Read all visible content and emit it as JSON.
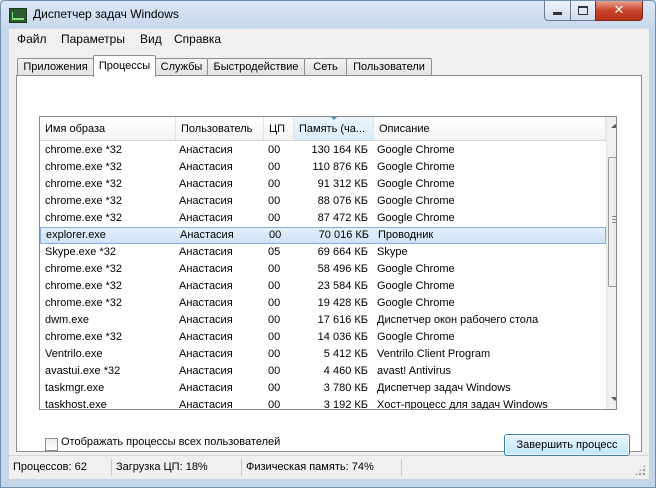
{
  "window": {
    "title": "Диспетчер задач Windows"
  },
  "menu": [
    "Файл",
    "Параметры",
    "Вид",
    "Справка"
  ],
  "tabs": [
    {
      "label": "Приложения",
      "active": false
    },
    {
      "label": "Процессы",
      "active": true
    },
    {
      "label": "Службы",
      "active": false
    },
    {
      "label": "Быстродействие",
      "active": false
    },
    {
      "label": "Сеть",
      "active": false
    },
    {
      "label": "Пользователи",
      "active": false
    }
  ],
  "processes": {
    "columns": [
      "Имя образа",
      "Пользователь",
      "ЦП",
      "Память (ча...",
      "Описание"
    ],
    "sorted_column": "Память (ча...",
    "rows": [
      {
        "name": "chrome.exe *32",
        "user": "Анастасия",
        "cpu": "00",
        "mem": "130 164 КБ",
        "desc": "Google Chrome"
      },
      {
        "name": "chrome.exe *32",
        "user": "Анастасия",
        "cpu": "00",
        "mem": "110 876 КБ",
        "desc": "Google Chrome"
      },
      {
        "name": "chrome.exe *32",
        "user": "Анастасия",
        "cpu": "00",
        "mem": "91 312 КБ",
        "desc": "Google Chrome"
      },
      {
        "name": "chrome.exe *32",
        "user": "Анастасия",
        "cpu": "00",
        "mem": "88 076 КБ",
        "desc": "Google Chrome"
      },
      {
        "name": "chrome.exe *32",
        "user": "Анастасия",
        "cpu": "00",
        "mem": "87 472 КБ",
        "desc": "Google Chrome"
      },
      {
        "name": "explorer.exe",
        "user": "Анастасия",
        "cpu": "00",
        "mem": "70 016 КБ",
        "desc": "Проводник",
        "selected": true
      },
      {
        "name": "Skype.exe *32",
        "user": "Анастасия",
        "cpu": "05",
        "mem": "69 664 КБ",
        "desc": "Skype"
      },
      {
        "name": "chrome.exe *32",
        "user": "Анастасия",
        "cpu": "00",
        "mem": "58 496 КБ",
        "desc": "Google Chrome"
      },
      {
        "name": "chrome.exe *32",
        "user": "Анастасия",
        "cpu": "00",
        "mem": "23 584 КБ",
        "desc": "Google Chrome"
      },
      {
        "name": "chrome.exe *32",
        "user": "Анастасия",
        "cpu": "00",
        "mem": "19 428 КБ",
        "desc": "Google Chrome"
      },
      {
        "name": "dwm.exe",
        "user": "Анастасия",
        "cpu": "00",
        "mem": "17 616 КБ",
        "desc": "Диспетчер окон рабочего стола"
      },
      {
        "name": "chrome.exe *32",
        "user": "Анастасия",
        "cpu": "00",
        "mem": "14 036 КБ",
        "desc": "Google Chrome"
      },
      {
        "name": "Ventrilo.exe",
        "user": "Анастасия",
        "cpu": "00",
        "mem": "5 412 КБ",
        "desc": "Ventrilo Client Program"
      },
      {
        "name": "avastui.exe *32",
        "user": "Анастасия",
        "cpu": "00",
        "mem": "4 460 КБ",
        "desc": "avast! Antivirus"
      },
      {
        "name": "taskmgr.exe",
        "user": "Анастасия",
        "cpu": "00",
        "mem": "3 780 КБ",
        "desc": "Диспетчер задач Windows"
      },
      {
        "name": "taskhost.exe",
        "user": "Анастасия",
        "cpu": "00",
        "mem": "3 192 КБ",
        "desc": "Хост-процесс для задач Windows"
      }
    ]
  },
  "controls": {
    "show_all_users_label": "Отображать процессы всех пользователей",
    "show_all_users_checked": false,
    "end_process_label": "Завершить процесс"
  },
  "status": {
    "processes": "Процессов: 62",
    "cpu": "Загрузка ЦП: 18%",
    "memory": "Физическая память: 74%"
  },
  "icons": {
    "app": "task-manager-icon",
    "minimize": "minimize-icon",
    "maximize": "maximize-icon",
    "close": "close-icon",
    "sort": "sort-arrow-icon",
    "scroll_up": "scroll-up-arrow-icon",
    "scroll_down": "scroll-down-arrow-icon"
  }
}
